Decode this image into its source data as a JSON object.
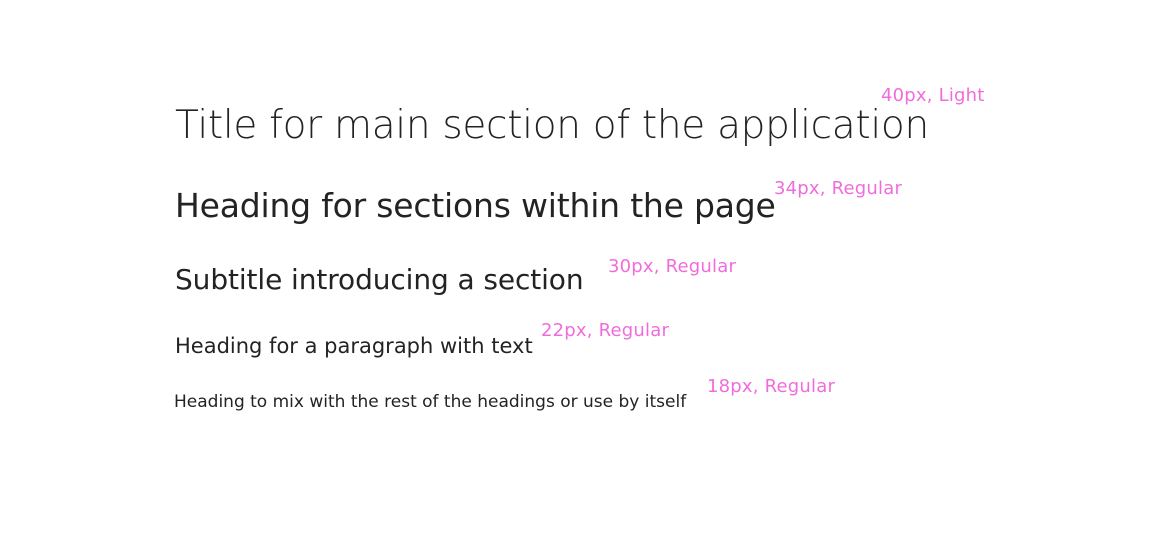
{
  "accent_color": "#f06cdc",
  "text_color": "#232323",
  "rows": [
    {
      "sample": "Title for main section of the application",
      "spec": "40px, Light"
    },
    {
      "sample": "Heading for sections within the page",
      "spec": "34px, Regular"
    },
    {
      "sample": "Subtitle introducing a section",
      "spec": "30px, Regular"
    },
    {
      "sample": "Heading for a paragraph with text",
      "spec": "22px, Regular"
    },
    {
      "sample": "Heading to mix with the rest of the headings or use by itself",
      "spec": "18px, Regular"
    }
  ]
}
